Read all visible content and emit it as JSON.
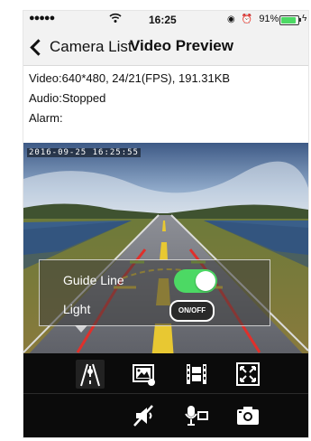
{
  "status_bar": {
    "signal": "●●●●●",
    "time": "16:25",
    "battery_percent": "91%",
    "battery_level": 0.91,
    "icons": [
      "wifi-icon",
      "lock-rotation-icon",
      "alarm-icon",
      "battery-icon",
      "charging-icon"
    ]
  },
  "nav": {
    "back_label": "Camera List",
    "title": "Video Preview"
  },
  "info": {
    "video": "Video:640*480, 24/21(FPS), 191.31KB",
    "audio": "Audio:Stopped",
    "alarm": "Alarm:"
  },
  "video": {
    "timestamp": "2016-09-25 16:25:55"
  },
  "overlay_panel": {
    "guide_line_label": "Guide Line",
    "guide_line_on": true,
    "light_label": "Light",
    "light_button_label": "ON/OFF"
  },
  "toolbar": {
    "row1": [
      "guide-line-icon",
      "gallery-icon",
      "video-settings-icon",
      "fullscreen-icon"
    ],
    "row2": [
      "mute-icon",
      "talk-icon",
      "snapshot-icon"
    ]
  },
  "colors": {
    "toggle_on": "#4cd964",
    "toolbar_bg": "#0b0b0b",
    "bar_bg": "#f2f2f2",
    "guide_red": "#e0302b",
    "guide_yellow": "#e8c832"
  }
}
